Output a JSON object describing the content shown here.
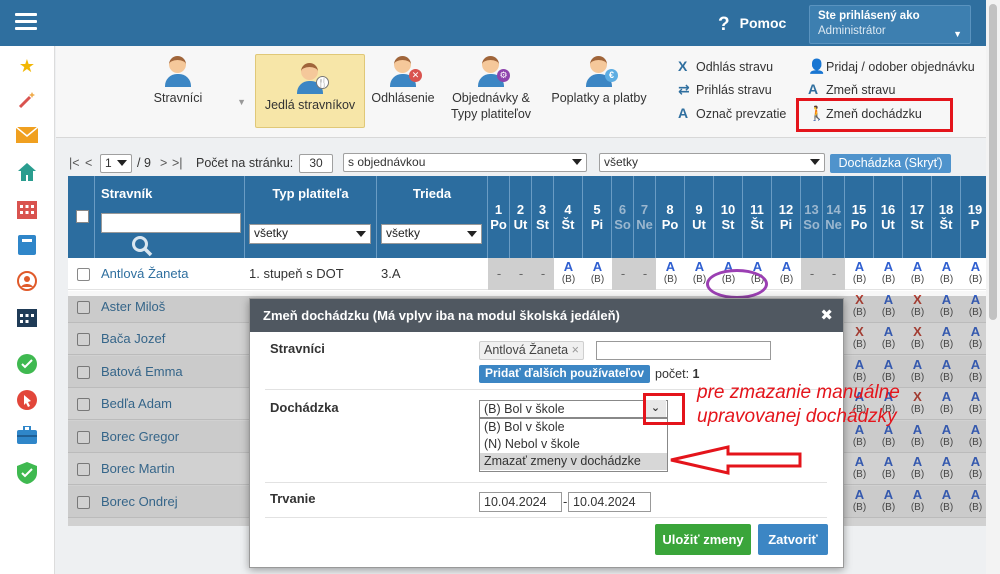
{
  "topbar": {
    "help_label": "Pomoc",
    "user_line1": "Ste prihlásený ako",
    "user_line2": "Administrátor"
  },
  "sidebar": {
    "icons": [
      "star-icon",
      "magic-wand-icon",
      "mail-icon",
      "home-icon",
      "calendar-grid-icon",
      "book-icon",
      "user-circle-icon",
      "calendar-icon",
      "check-circle-icon",
      "pointer-icon",
      "briefcase-icon",
      "shield-check-icon"
    ]
  },
  "toolbar": {
    "buttons": [
      {
        "label": "Stravníci"
      },
      {
        "label": "Jedlá stravníkov"
      },
      {
        "label": "Odhlásenie"
      },
      {
        "label": "Objednávky &",
        "label2": "Typy platiteľov"
      },
      {
        "label": "Poplatky a platby"
      }
    ],
    "actions_left": [
      "Odhlás stravu",
      "Prihlás stravu",
      "Označ prevzatie"
    ],
    "actions_right": [
      "Pridaj / odober objednávku",
      "Zmeň stravu",
      "Zmeň dochádzku"
    ]
  },
  "pager": {
    "first": "|<",
    "prev": "<",
    "page": "1",
    "of": "/ 9",
    "next": ">",
    "last": ">|",
    "per_page_label": "Počet na stránku:",
    "per_page": "30",
    "filter1": "s objednávkou",
    "filter2": "všetky",
    "attendance_button": "Dochádzka (Skryť)"
  },
  "grid": {
    "col_stravnik": "Stravník",
    "col_typ": "Typ platiteľa",
    "col_trieda": "Trieda",
    "typ_filter": "všetky",
    "trieda_filter": "všetky",
    "days": [
      {
        "n": "1",
        "d": "Po"
      },
      {
        "n": "2",
        "d": "Ut"
      },
      {
        "n": "3",
        "d": "St"
      },
      {
        "n": "4",
        "d": "Št"
      },
      {
        "n": "5",
        "d": "Pi"
      },
      {
        "n": "6",
        "d": "So"
      },
      {
        "n": "7",
        "d": "Ne"
      },
      {
        "n": "8",
        "d": "Po"
      },
      {
        "n": "9",
        "d": "Ut"
      },
      {
        "n": "10",
        "d": "St"
      },
      {
        "n": "11",
        "d": "Št"
      },
      {
        "n": "12",
        "d": "Pi"
      },
      {
        "n": "13",
        "d": "So"
      },
      {
        "n": "14",
        "d": "Ne"
      },
      {
        "n": "15",
        "d": "Po"
      },
      {
        "n": "16",
        "d": "Ut"
      },
      {
        "n": "17",
        "d": "St"
      },
      {
        "n": "18",
        "d": "Št"
      },
      {
        "n": "19",
        "d": "P"
      }
    ],
    "rows": [
      {
        "name": "Antlová Žaneta",
        "typ": "1. stupeň  s DOT",
        "trieda": "3.A"
      },
      {
        "name": "Aster Miloš"
      },
      {
        "name": "Bača Jozef"
      },
      {
        "name": "Batová Emma"
      },
      {
        "name": "Bedľa Adam"
      },
      {
        "name": "Borec Gregor"
      },
      {
        "name": "Borec Martin"
      },
      {
        "name": "Borec Ondrej"
      }
    ],
    "dash": "-",
    "mark_A": "A",
    "mark_X": "X",
    "sub_B": "(B)"
  },
  "modal": {
    "title": "Zmeň dochádzku (Má vplyv iba na modul školská jedáleň)",
    "close": "✖",
    "label_stravnici": "Stravníci",
    "tag": "Antlová Žaneta",
    "tag_remove": "×",
    "add_button": "Pridať ďalších používateľov",
    "count_label": "počet:",
    "count_value": "1",
    "label_dochadzka": "Dochádzka",
    "selected": "(B) Bol v škole",
    "options": [
      "(B) Bol v škole",
      "(N) Nebol v škole",
      "Zmazať zmeny v dochádzke"
    ],
    "label_trvanie": "Trvanie",
    "date_from": "10.04.2024",
    "date_sep": "-",
    "date_to": "10.04.2024",
    "save": "Uložiť zmeny",
    "cancel": "Zatvoriť"
  },
  "annotation": {
    "line1": "pre zmazanie manuálne",
    "line2": "upravovanej dochádzky"
  },
  "colors": {
    "header_blue": "#2f6f9f",
    "highlight_red": "#e4141b",
    "active_yellow": "#f7e6a8",
    "save_green": "#3aa53a"
  }
}
